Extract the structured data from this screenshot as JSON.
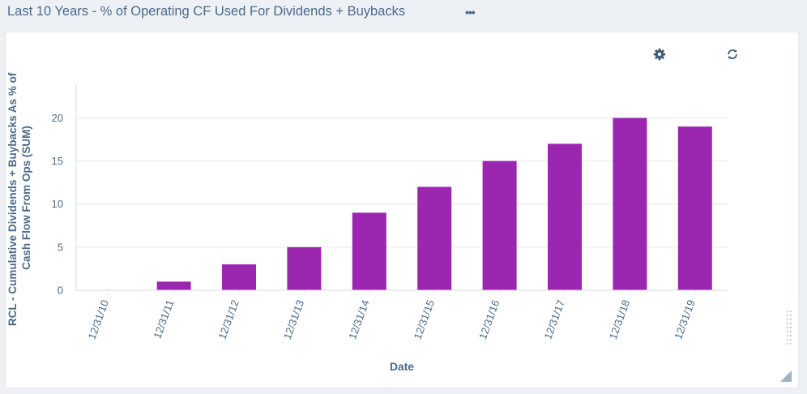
{
  "header": {
    "title": "Last 10 Years - % of Operating CF Used For Dividends + Buybacks",
    "more_label": "•••"
  },
  "toolbar": {
    "settings_icon": "gear-icon",
    "refresh_icon": "refresh-icon"
  },
  "colors": {
    "bar": "#9b27b0",
    "axis_text": "#4c6a88",
    "grid": "#e4e8ee",
    "background": "#edf1f6"
  },
  "chart_data": {
    "type": "bar",
    "categories": [
      "12/31/10",
      "12/31/11",
      "12/31/12",
      "12/31/13",
      "12/31/14",
      "12/31/15",
      "12/31/16",
      "12/31/17",
      "12/31/18",
      "12/31/19"
    ],
    "values": [
      0,
      1,
      3,
      5,
      9,
      12,
      15,
      17,
      20,
      19
    ],
    "yticks": [
      0,
      5,
      10,
      15,
      20
    ],
    "ylim": [
      0,
      23.9
    ],
    "xlabel": "Date",
    "ylabel_lines": [
      "RCL - Cumulative Dividends + Buybacks As % of",
      "Cash Flow From Ops (SUM)"
    ],
    "grid": true
  }
}
